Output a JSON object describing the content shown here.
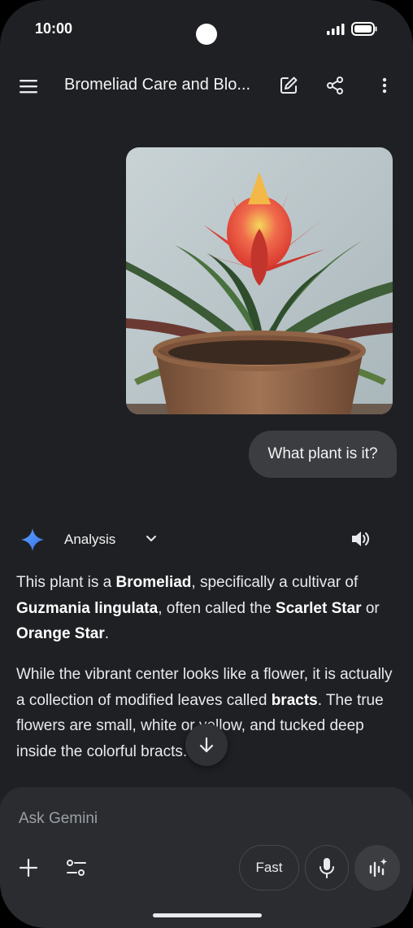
{
  "status": {
    "time": "10:00"
  },
  "header": {
    "title": "Bromeliad Care and Blo...",
    "icons": [
      "menu-icon",
      "edit-icon",
      "share-icon",
      "more-vert-icon"
    ]
  },
  "chat": {
    "user_message": "What plant is it?",
    "mode_label": "Analysis",
    "answer": {
      "p1": {
        "t1": "This plant is a ",
        "b1": "Bromeliad",
        "t2": ", specifically a cultivar of ",
        "b2": "Guzmania lingulata",
        "t3": ", often called the ",
        "b3": "Scarlet Star",
        "t4": " or ",
        "b4": "Orange Star",
        "t5": "."
      },
      "p2": {
        "t1": "While the vibrant center looks like a flower, it is actually a collection of modified leaves called ",
        "b1": "bracts",
        "t2": ". The true flowers are small, white or yellow, and tucked deep inside the colorful bracts."
      }
    }
  },
  "composer": {
    "placeholder": "Ask Gemini",
    "model_label": "Fast"
  },
  "colors": {
    "background": "#1f2023",
    "bubble": "#3c3d40",
    "composer": "#2b2c2f",
    "gemini_spark": "#4f8ef7"
  }
}
